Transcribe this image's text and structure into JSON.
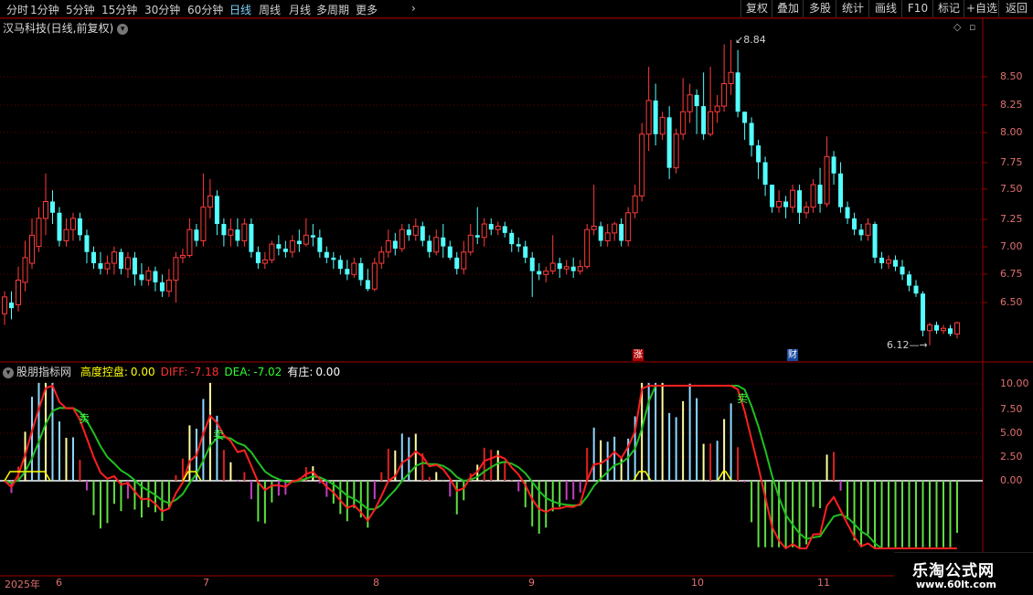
{
  "toolbar": {
    "periods": [
      {
        "label": "分时",
        "active": false
      },
      {
        "label": "1分钟",
        "active": false
      },
      {
        "label": "5分钟",
        "active": false
      },
      {
        "label": "15分钟",
        "active": false
      },
      {
        "label": "30分钟",
        "active": false
      },
      {
        "label": "60分钟",
        "active": false
      },
      {
        "label": "日线",
        "active": true
      },
      {
        "label": "周线",
        "active": false
      },
      {
        "label": "月线",
        "active": false
      },
      {
        "label": "多周期",
        "active": false
      },
      {
        "label": "更多",
        "active": false
      }
    ],
    "more_arrow": "›",
    "right_buttons": [
      "复权",
      "叠加",
      "多股",
      "统计",
      "画线",
      "F10",
      "标记",
      "+自选",
      "返回"
    ]
  },
  "chart_title": "汉马科技(日线,前复权)",
  "indicator": {
    "name": "股朋指标网",
    "fields": [
      {
        "label": "高度控盘:",
        "value": "0.00",
        "color": "#ffff00"
      },
      {
        "label": "DIFF:",
        "value": "-7.18",
        "color": "#ff3030"
      },
      {
        "label": "DEA:",
        "value": "-7.02",
        "color": "#30ff30"
      },
      {
        "label": "有庄:",
        "value": "0.00",
        "color": "#ffffff"
      }
    ]
  },
  "price_axis": [
    "8.50",
    "8.25",
    "8.00",
    "7.75",
    "7.50",
    "7.25",
    "7.00",
    "6.75",
    "6.50"
  ],
  "ind_axis": [
    "10.00",
    "7.50",
    "5.00",
    "2.50",
    "0.00"
  ],
  "date_axis": [
    {
      "label": "2025年"
    },
    {
      "label": "6"
    },
    {
      "label": "7"
    },
    {
      "label": "8"
    },
    {
      "label": "9"
    },
    {
      "label": "10"
    },
    {
      "label": "11"
    }
  ],
  "markers": {
    "high": "8.84",
    "low": "6.12",
    "zhang": "涨",
    "cai": "财",
    "sell": "卖"
  },
  "watermark": {
    "line1": "乐淘公式网",
    "line2": "www.60lt.com"
  },
  "colors": {
    "up": "#ff3c3c",
    "down": "#54ffff",
    "grid": "#6a0000",
    "diff": "#ff2020",
    "dea": "#20c020"
  },
  "chart_data": {
    "type": "candlestick",
    "ylim": [
      6.1,
      8.9
    ],
    "candles": [
      [
        6.4,
        6.55,
        6.3,
        6.6
      ],
      [
        6.5,
        6.45,
        6.35,
        6.6
      ],
      [
        6.48,
        6.7,
        6.42,
        6.82
      ],
      [
        6.68,
        6.9,
        6.6,
        7.05
      ],
      [
        6.85,
        7.1,
        6.8,
        7.25
      ],
      [
        7.0,
        7.25,
        6.95,
        7.35
      ],
      [
        7.25,
        7.4,
        7.1,
        7.65
      ],
      [
        7.4,
        7.3,
        7.2,
        7.5
      ],
      [
        7.3,
        7.05,
        7.0,
        7.35
      ],
      [
        7.05,
        7.15,
        7.0,
        7.25
      ],
      [
        7.15,
        7.25,
        7.05,
        7.3
      ],
      [
        7.25,
        7.1,
        7.05,
        7.3
      ],
      [
        7.1,
        6.95,
        6.85,
        7.15
      ],
      [
        6.95,
        6.85,
        6.8,
        7.0
      ],
      [
        6.85,
        6.8,
        6.75,
        6.95
      ],
      [
        6.8,
        6.85,
        6.75,
        6.92
      ],
      [
        6.85,
        6.95,
        6.75,
        7.0
      ],
      [
        6.95,
        6.8,
        6.75,
        6.98
      ],
      [
        6.8,
        6.9,
        6.72,
        6.95
      ],
      [
        6.9,
        6.75,
        6.65,
        6.95
      ],
      [
        6.75,
        6.7,
        6.65,
        6.85
      ],
      [
        6.7,
        6.78,
        6.65,
        6.82
      ],
      [
        6.78,
        6.68,
        6.6,
        6.82
      ],
      [
        6.68,
        6.6,
        6.55,
        6.75
      ],
      [
        6.6,
        6.7,
        6.55,
        6.8
      ],
      [
        6.7,
        6.9,
        6.5,
        6.95
      ],
      [
        6.9,
        6.92,
        6.85,
        6.98
      ],
      [
        6.92,
        7.15,
        6.9,
        7.25
      ],
      [
        7.15,
        7.05,
        7.0,
        7.2
      ],
      [
        7.05,
        7.35,
        7.0,
        7.65
      ],
      [
        7.35,
        7.45,
        7.25,
        7.6
      ],
      [
        7.45,
        7.2,
        7.1,
        7.5
      ],
      [
        7.2,
        7.1,
        7.0,
        7.25
      ],
      [
        7.1,
        7.15,
        7.0,
        7.25
      ],
      [
        7.15,
        7.05,
        7.0,
        7.25
      ],
      [
        7.05,
        7.2,
        7.0,
        7.25
      ],
      [
        7.2,
        6.95,
        6.9,
        7.25
      ],
      [
        6.95,
        6.85,
        6.8,
        7.0
      ],
      [
        6.85,
        6.88,
        6.8,
        6.95
      ],
      [
        6.88,
        7.02,
        6.85,
        7.05
      ],
      [
        7.02,
        6.98,
        6.92,
        7.1
      ],
      [
        6.98,
        6.95,
        6.9,
        7.05
      ],
      [
        6.95,
        7.05,
        6.9,
        7.1
      ],
      [
        7.05,
        7.02,
        6.95,
        7.15
      ],
      [
        7.02,
        7.1,
        7.0,
        7.25
      ],
      [
        7.1,
        7.08,
        7.0,
        7.2
      ],
      [
        7.08,
        6.95,
        6.9,
        7.15
      ],
      [
        6.95,
        6.9,
        6.85,
        7.0
      ],
      [
        6.9,
        6.88,
        6.8,
        6.95
      ],
      [
        6.88,
        6.8,
        6.75,
        6.92
      ],
      [
        6.8,
        6.75,
        6.7,
        6.88
      ],
      [
        6.75,
        6.85,
        6.72,
        6.9
      ],
      [
        6.85,
        6.7,
        6.65,
        6.9
      ],
      [
        6.7,
        6.62,
        6.6,
        6.8
      ],
      [
        6.62,
        6.85,
        6.6,
        6.9
      ],
      [
        6.85,
        6.95,
        6.8,
        7.0
      ],
      [
        6.95,
        7.05,
        6.9,
        7.15
      ],
      [
        7.05,
        6.98,
        6.92,
        7.12
      ],
      [
        6.98,
        7.15,
        6.95,
        7.2
      ],
      [
        7.15,
        7.1,
        7.05,
        7.2
      ],
      [
        7.1,
        7.18,
        7.05,
        7.25
      ],
      [
        7.18,
        7.05,
        7.0,
        7.22
      ],
      [
        7.05,
        6.95,
        6.9,
        7.1
      ],
      [
        6.95,
        7.08,
        6.92,
        7.15
      ],
      [
        7.08,
        7.0,
        6.9,
        7.2
      ],
      [
        7.0,
        6.9,
        6.88,
        7.05
      ],
      [
        6.9,
        6.8,
        6.75,
        6.95
      ],
      [
        6.8,
        6.95,
        6.75,
        7.05
      ],
      [
        6.95,
        7.1,
        6.92,
        7.2
      ],
      [
        7.1,
        7.08,
        7.02,
        7.35
      ],
      [
        7.08,
        7.2,
        7.0,
        7.25
      ],
      [
        7.2,
        7.15,
        7.1,
        7.25
      ],
      [
        7.15,
        7.18,
        7.1,
        7.22
      ],
      [
        7.18,
        7.12,
        7.08,
        7.22
      ],
      [
        7.12,
        7.02,
        6.95,
        7.15
      ],
      [
        7.02,
        7.0,
        6.95,
        7.08
      ],
      [
        7.0,
        6.9,
        6.85,
        7.05
      ],
      [
        6.9,
        6.78,
        6.55,
        6.95
      ],
      [
        6.78,
        6.75,
        6.7,
        6.85
      ],
      [
        6.75,
        6.78,
        6.68,
        6.82
      ],
      [
        6.78,
        6.85,
        6.75,
        7.1
      ],
      [
        6.85,
        6.8,
        6.72,
        6.9
      ],
      [
        6.8,
        6.82,
        6.75,
        6.88
      ],
      [
        6.82,
        6.78,
        6.72,
        6.9
      ],
      [
        6.78,
        6.82,
        6.75,
        6.88
      ],
      [
        6.82,
        7.15,
        6.8,
        7.2
      ],
      [
        7.15,
        7.18,
        7.1,
        7.55
      ],
      [
        7.18,
        7.05,
        7.0,
        7.22
      ],
      [
        7.05,
        7.12,
        7.0,
        7.2
      ],
      [
        7.12,
        7.2,
        7.05,
        7.22
      ],
      [
        7.2,
        7.05,
        7.0,
        7.25
      ],
      [
        7.05,
        7.3,
        7.0,
        7.35
      ],
      [
        7.3,
        7.45,
        7.25,
        7.55
      ],
      [
        7.45,
        8.0,
        7.4,
        8.1
      ],
      [
        8.0,
        8.3,
        7.85,
        8.6
      ],
      [
        8.3,
        8.0,
        7.9,
        8.45
      ],
      [
        8.0,
        8.15,
        7.95,
        8.2
      ],
      [
        8.15,
        7.7,
        7.6,
        8.25
      ],
      [
        7.7,
        8.0,
        7.65,
        8.05
      ],
      [
        8.0,
        8.2,
        7.95,
        8.5
      ],
      [
        8.2,
        8.35,
        8.1,
        8.45
      ],
      [
        8.35,
        8.25,
        8.0,
        8.4
      ],
      [
        8.25,
        8.0,
        7.95,
        8.55
      ],
      [
        8.0,
        8.2,
        7.98,
        8.6
      ],
      [
        8.2,
        8.25,
        8.1,
        8.35
      ],
      [
        8.25,
        8.45,
        8.2,
        8.8
      ],
      [
        8.45,
        8.55,
        8.35,
        8.84
      ],
      [
        8.55,
        8.2,
        8.15,
        8.75
      ],
      [
        8.2,
        8.1,
        7.95,
        8.2
      ],
      [
        8.1,
        7.9,
        7.8,
        8.15
      ],
      [
        7.9,
        7.75,
        7.6,
        7.95
      ],
      [
        7.75,
        7.55,
        7.45,
        7.8
      ],
      [
        7.55,
        7.35,
        7.3,
        7.55
      ],
      [
        7.35,
        7.4,
        7.3,
        7.5
      ],
      [
        7.4,
        7.35,
        7.25,
        7.45
      ],
      [
        7.35,
        7.5,
        7.3,
        7.55
      ],
      [
        7.5,
        7.3,
        7.2,
        7.55
      ],
      [
        7.3,
        7.35,
        7.25,
        7.4
      ],
      [
        7.35,
        7.55,
        7.3,
        7.6
      ],
      [
        7.55,
        7.38,
        7.3,
        7.7
      ],
      [
        7.38,
        7.8,
        7.35,
        7.98
      ],
      [
        7.8,
        7.65,
        7.55,
        7.85
      ],
      [
        7.65,
        7.35,
        7.3,
        7.75
      ],
      [
        7.35,
        7.25,
        7.2,
        7.4
      ],
      [
        7.25,
        7.15,
        7.1,
        7.3
      ],
      [
        7.15,
        7.1,
        7.05,
        7.2
      ],
      [
        7.1,
        7.2,
        7.05,
        7.25
      ],
      [
        7.2,
        6.9,
        6.85,
        7.22
      ],
      [
        6.9,
        6.85,
        6.8,
        6.95
      ],
      [
        6.85,
        6.88,
        6.8,
        6.92
      ],
      [
        6.88,
        6.82,
        6.78,
        6.92
      ],
      [
        6.82,
        6.75,
        6.7,
        6.88
      ],
      [
        6.75,
        6.65,
        6.6,
        6.78
      ],
      [
        6.65,
        6.58,
        6.55,
        6.7
      ],
      [
        6.58,
        6.25,
        6.2,
        6.6
      ],
      [
        6.25,
        6.3,
        6.12,
        6.32
      ],
      [
        6.3,
        6.25,
        6.22,
        6.33
      ],
      [
        6.25,
        6.27,
        6.22,
        6.3
      ],
      [
        6.27,
        6.22,
        6.2,
        6.3
      ],
      [
        6.22,
        6.32,
        6.18,
        6.33
      ]
    ],
    "markers": [
      {
        "label": "8.84",
        "candle_index": 112
      },
      {
        "label": "6.12",
        "candle_index": 143
      }
    ]
  }
}
